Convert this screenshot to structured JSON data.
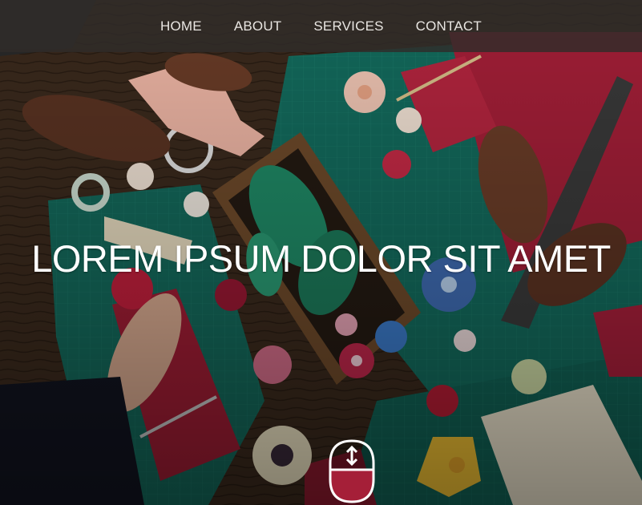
{
  "nav": {
    "items": [
      {
        "label": "HOME"
      },
      {
        "label": "ABOUT"
      },
      {
        "label": "SERVICES"
      },
      {
        "label": "CONTACT"
      }
    ]
  },
  "hero": {
    "title": "LOREM IPSUM DOLOR SIT AMET",
    "scroll_icon": "mouse-scroll-icon"
  },
  "colors": {
    "navbar_bg": "#302c2a",
    "nav_text": "#e9e6e2",
    "title_text": "#ffffff",
    "accent_red": "#a51f38",
    "mat_teal": "#136b5d"
  }
}
